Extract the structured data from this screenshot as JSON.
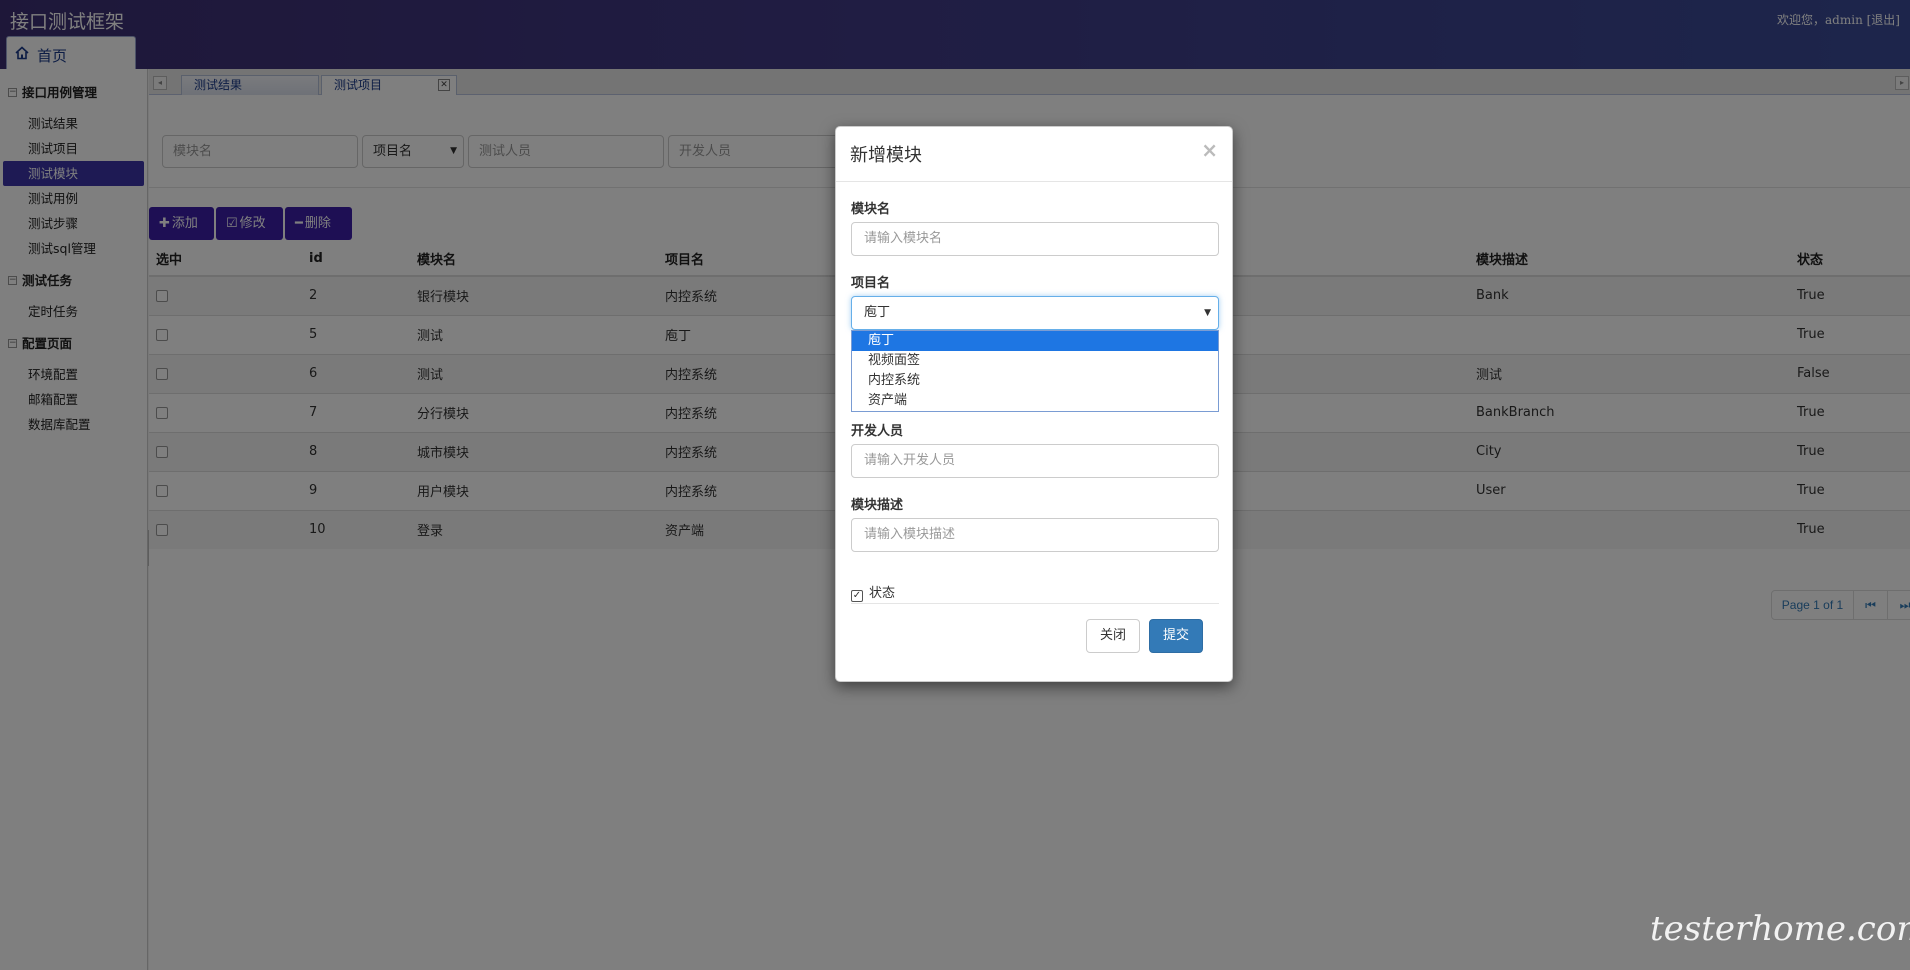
{
  "app": {
    "title": "接口测试框架",
    "welcome": "欢迎您，admin [退出]",
    "home_tab": "首页"
  },
  "sidebar": {
    "groups": [
      {
        "title": "接口用例管理",
        "items": [
          "测试结果",
          "测试项目",
          "测试模块",
          "测试用例",
          "测试步骤",
          "测试sql管理"
        ]
      },
      {
        "title": "测试任务",
        "items": [
          "定时任务"
        ]
      },
      {
        "title": "配置页面",
        "items": [
          "环境配置",
          "邮箱配置",
          "数据库配置"
        ]
      }
    ],
    "active_item": "测试模块"
  },
  "content_tabs": [
    "测试结果",
    "测试项目"
  ],
  "search": {
    "module_placeholder": "模块名",
    "project_select": "项目名",
    "tester_placeholder": "测试人员",
    "developer_placeholder": "开发人员"
  },
  "toolbar": {
    "add": "添加",
    "edit": "修改",
    "delete": "删除"
  },
  "table": {
    "columns": [
      "选中",
      "id",
      "模块名",
      "项目名",
      "模块描述",
      "状态"
    ],
    "rows": [
      {
        "id": "2",
        "module": "银行模块",
        "project": "内控系统",
        "desc": "Bank",
        "status": "True"
      },
      {
        "id": "5",
        "module": "测试",
        "project": "庖丁",
        "desc": "",
        "status": "True"
      },
      {
        "id": "6",
        "module": "测试",
        "project": "内控系统",
        "desc": "测试",
        "status": "False"
      },
      {
        "id": "7",
        "module": "分行模块",
        "project": "内控系统",
        "desc": "BankBranch",
        "status": "True"
      },
      {
        "id": "8",
        "module": "城市模块",
        "project": "内控系统",
        "desc": "City",
        "status": "True"
      },
      {
        "id": "9",
        "module": "用户模块",
        "project": "内控系统",
        "desc": "User",
        "status": "True"
      },
      {
        "id": "10",
        "module": "登录",
        "project": "资产端",
        "desc": "",
        "status": "True"
      }
    ]
  },
  "pager": {
    "info": "Page 1 of 1"
  },
  "modal": {
    "title": "新增模块",
    "close_symbol": "×",
    "module_label": "模块名",
    "module_placeholder": "请输入模块名",
    "project_label": "项目名",
    "project_value": "庖丁",
    "project_options": [
      "庖丁",
      "视频面签",
      "内控系统",
      "资产端"
    ],
    "developer_label": "开发人员",
    "developer_placeholder": "请输入开发人员",
    "desc_label": "模块描述",
    "desc_placeholder": "请输入模块描述",
    "status_label": "状态",
    "close_button": "关闭",
    "submit_button": "提交"
  },
  "watermark": "testerhome.com"
}
